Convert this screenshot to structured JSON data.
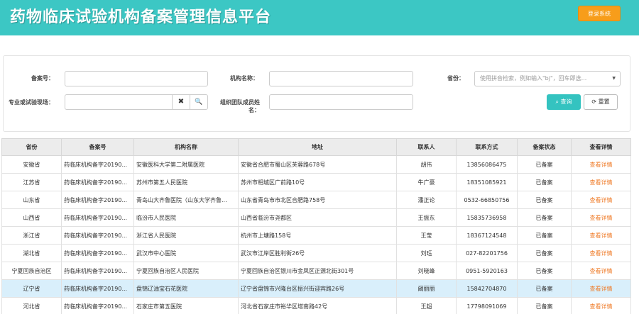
{
  "header": {
    "title": "药物临床试验机构备案管理信息平台",
    "login_label": "登录系统"
  },
  "search": {
    "record_no_label": "备案号：",
    "org_name_label": "机构名称：",
    "province_label": "省份：",
    "province_placeholder": "使用拼音检索，例如输入\"bj\"，回车即选...",
    "specialty_label": "专业或试验现场：",
    "clear_icon": "✖",
    "search_icon": "🔍",
    "team_label": "组织团队成员姓名：",
    "query_label": "查询",
    "reset_label": "重置"
  },
  "table": {
    "columns": [
      "省份",
      "备案号",
      "机构名称",
      "地址",
      "联系人",
      "联系方式",
      "备案状态",
      "查看详情"
    ],
    "rows": [
      [
        "安徽省",
        "药临床机构备字20190...",
        "安徽医科大学第二附属医院",
        "安徽省合肥市蜀山区芙蓉路678号",
        "胡伟",
        "13856086475",
        "已备案",
        "查看详情"
      ],
      [
        "江苏省",
        "药临床机构备字20190...",
        "苏州市第五人民医院",
        "苏州市相城区广前路10号",
        "牛广豪",
        "18351085921",
        "已备案",
        "查看详情"
      ],
      [
        "山东省",
        "药临床机构备字20190...",
        "青岛山大齐鲁医院（山东大学齐鲁...",
        "山东省青岛市市北区合肥路758号",
        "潘正论",
        "0532-66850756",
        "已备案",
        "查看详情"
      ],
      [
        "山西省",
        "药临床机构备字20190...",
        "临汾市人民医院",
        "山西省临汾市尧都区",
        "王振东",
        "15835736958",
        "已备案",
        "查看详情"
      ],
      [
        "浙江省",
        "药临床机构备字20190...",
        "浙江省人民医院",
        "杭州市上塘路158号",
        "王莹",
        "18367124548",
        "已备案",
        "查看详情"
      ],
      [
        "湖北省",
        "药临床机构备字20190...",
        "武汉市中心医院",
        "武汉市江岸区胜利街26号",
        "刘珏",
        "027-82201756",
        "已备案",
        "查看详情"
      ],
      [
        "宁夏回族自治区",
        "药临床机构备字20190...",
        "宁夏回族自治区人民医院",
        "宁夏回族自治区银川市金凤区正源北街301号",
        "刘晓峰",
        "0951-5920163",
        "已备案",
        "查看详情"
      ],
      [
        "辽宁省",
        "药临床机构备字20190...",
        "盘锦辽油宝石花医院",
        "辽宁省盘锦市兴隆台区振兴街迎宾路26号",
        "阚丽丽",
        "15842704870",
        "已备案",
        "查看详情"
      ],
      [
        "河北省",
        "药临床机构备字20190...",
        "石家庄市第五医院",
        "河北省石家庄市裕华区塔南路42号",
        "王超",
        "17798091069",
        "已备案",
        "查看详情"
      ]
    ],
    "selected_row": 7
  }
}
